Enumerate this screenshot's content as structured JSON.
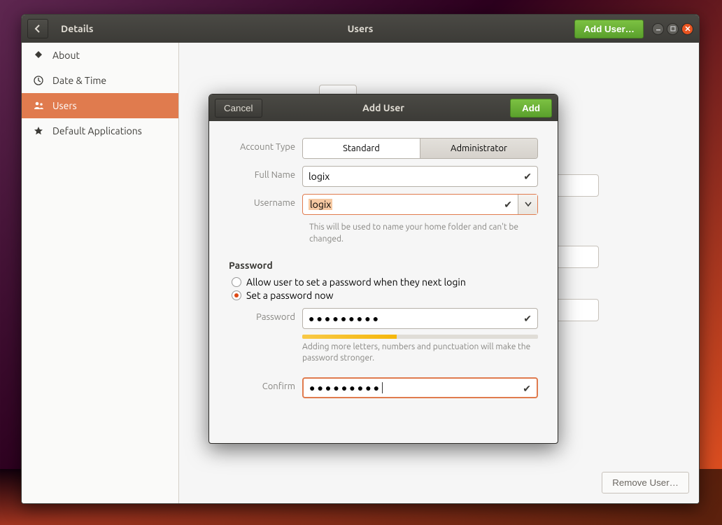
{
  "header": {
    "back_label": "Details",
    "center_title": "Users",
    "add_user_button": "Add User…"
  },
  "sidebar": {
    "items": [
      {
        "id": "about",
        "label": "About",
        "icon": "plus"
      },
      {
        "id": "datetime",
        "label": "Date & Time",
        "icon": "clock"
      },
      {
        "id": "users",
        "label": "Users",
        "icon": "users",
        "active": true
      },
      {
        "id": "defapps",
        "label": "Default Applications",
        "icon": "star"
      }
    ]
  },
  "content": {
    "remove_user_button": "Remove User…"
  },
  "modal": {
    "title": "Add User",
    "cancel_label": "Cancel",
    "add_label": "Add",
    "labels": {
      "account_type": "Account Type",
      "full_name": "Full Name",
      "username": "Username",
      "password": "Password",
      "confirm": "Confirm"
    },
    "account_type": {
      "standard": "Standard",
      "administrator": "Administrator",
      "selected": "Standard"
    },
    "full_name": "logix",
    "username": "logix",
    "username_help": "This will be used to name your home folder and can't be changed.",
    "password_section_title": "Password",
    "radio_allow_later": "Allow user to set a password when they next login",
    "radio_set_now": "Set a password now",
    "radio_selected": "now",
    "password_value_masked": "●●●●●●●●●",
    "confirm_value_masked": "●●●●●●●●●",
    "strength_percent": 40,
    "strength_help": "Adding more letters, numbers and punctuation will make the password stronger."
  }
}
